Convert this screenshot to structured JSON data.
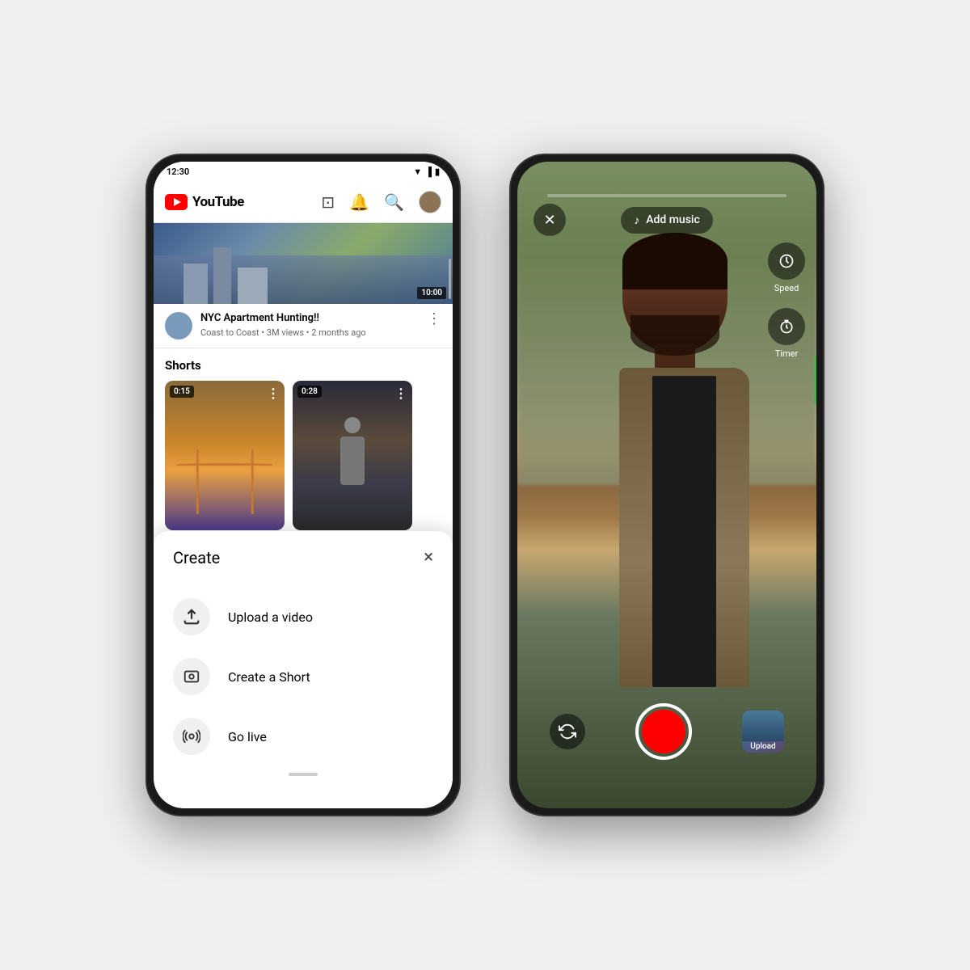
{
  "phone1": {
    "status": {
      "time": "12:30",
      "icons": [
        "wifi",
        "signal",
        "battery"
      ]
    },
    "header": {
      "logo_text": "YouTube",
      "icons": [
        "cast",
        "bell",
        "search",
        "profile"
      ]
    },
    "video": {
      "title": "NYC Apartment Hunting!!",
      "channel": "Coast to Coast",
      "views": "3M views",
      "age": "2 months ago",
      "duration": "10:00"
    },
    "shorts": {
      "label": "Shorts",
      "items": [
        {
          "duration": "0:15"
        },
        {
          "duration": "0:28"
        }
      ]
    },
    "create_sheet": {
      "title": "Create",
      "close_label": "×",
      "items": [
        {
          "icon": "upload",
          "label": "Upload a video"
        },
        {
          "icon": "camera",
          "label": "Create a Short"
        },
        {
          "icon": "live",
          "label": "Go live"
        }
      ]
    }
  },
  "phone2": {
    "controls": {
      "close_label": "×",
      "add_music_label": "Add music",
      "speed_label": "Speed",
      "timer_label": "Timer",
      "upload_label": "Upload"
    }
  }
}
